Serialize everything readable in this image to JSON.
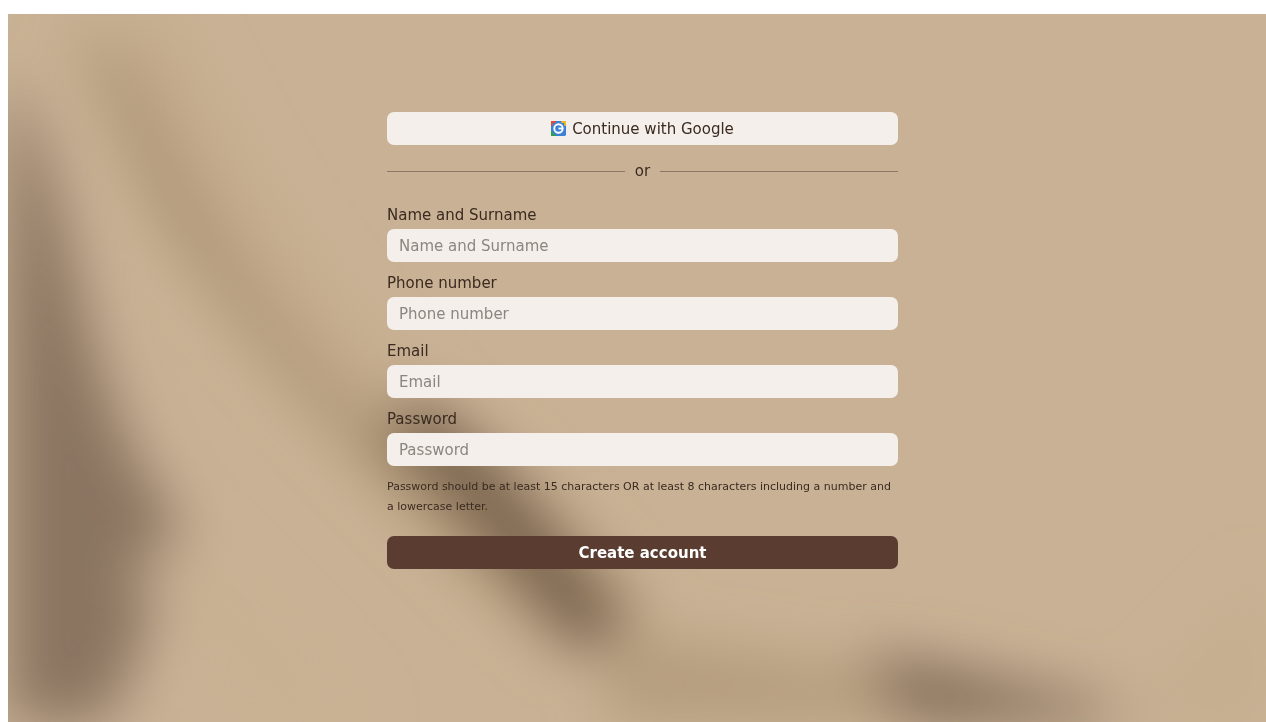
{
  "google_button": {
    "label": "Continue with Google"
  },
  "divider": {
    "label": "or"
  },
  "fields": [
    {
      "label": "Name and Surname",
      "placeholder": "Name and Surname"
    },
    {
      "label": "Phone number",
      "placeholder": "Phone number"
    },
    {
      "label": "Email",
      "placeholder": "Email"
    },
    {
      "label": "Password",
      "placeholder": "Password"
    }
  ],
  "password_hint": "Password should be at least 15 characters OR at least 8 characters including a number and a lowercase letter.",
  "submit_button": {
    "label": "Create account"
  }
}
